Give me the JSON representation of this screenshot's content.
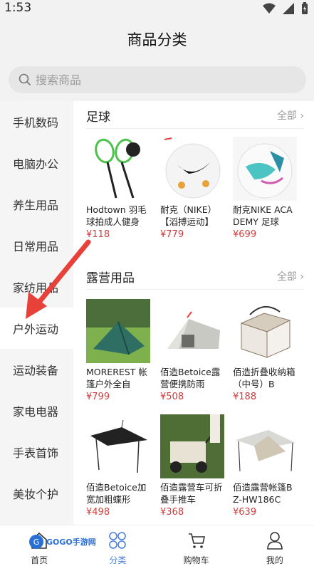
{
  "status": {
    "time": "1:53"
  },
  "header": {
    "title": "商品分类"
  },
  "search": {
    "placeholder": "搜索商品"
  },
  "sidebar": {
    "items": [
      {
        "label": "手机数码"
      },
      {
        "label": "电脑办公"
      },
      {
        "label": "养生用品"
      },
      {
        "label": "日常用品"
      },
      {
        "label": "家纺用品"
      },
      {
        "label": "户外运动"
      },
      {
        "label": "运动装备"
      },
      {
        "label": "家电电器"
      },
      {
        "label": "手表首饰"
      },
      {
        "label": "美妆个护"
      }
    ],
    "active_index": 5
  },
  "sections": [
    {
      "title": "足球",
      "more": "全部",
      "products": [
        {
          "name": "Hodtown 羽毛球拍成人健身",
          "price": "¥118",
          "icon": "badminton-racket"
        },
        {
          "name": "耐克（NIKE）【滔搏运动】",
          "price": "¥779",
          "icon": "nike-football"
        },
        {
          "name": "耐克NIKE ACADEMY 足球",
          "price": "¥699",
          "icon": "nike-football-blue"
        }
      ]
    },
    {
      "title": "露营用品",
      "more": "全部",
      "products": [
        {
          "name": "MOREREST 帐篷户外全自",
          "price": "¥799",
          "icon": "green-tent"
        },
        {
          "name": "佰造Betoice露营便携防雨",
          "price": "¥508",
          "icon": "grey-tent"
        },
        {
          "name": "佰造折叠收纳箱（中号）B",
          "price": "¥188",
          "icon": "storage-box"
        },
        {
          "name": "佰造Betoice加宽加粗蝶形",
          "price": "¥498",
          "icon": "canopy"
        },
        {
          "name": "佰造露营车可折叠手推车",
          "price": "¥368",
          "icon": "camp-cart"
        },
        {
          "name": "佰造露营帐篷BZ-HW186C",
          "price": "¥639",
          "icon": "tent-canopy"
        }
      ]
    }
  ],
  "tabbar": {
    "tabs": [
      {
        "label": "首页",
        "icon": "home-icon"
      },
      {
        "label": "分类",
        "icon": "category-icon"
      },
      {
        "label": "购物车",
        "icon": "cart-icon"
      },
      {
        "label": "我的",
        "icon": "user-icon"
      }
    ],
    "active_index": 1
  },
  "watermark": {
    "text": "GOGO手游网"
  },
  "colors": {
    "accent": "#4a7fe0",
    "price": "#d23b3b",
    "annotation_arrow": "#e8413a"
  }
}
